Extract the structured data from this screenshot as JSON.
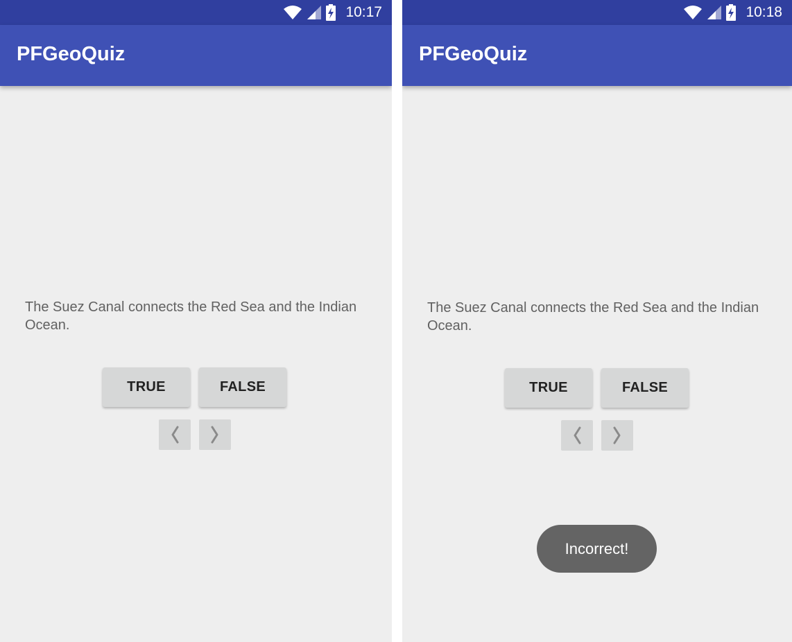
{
  "screens": [
    {
      "status_time": "10:17",
      "app_title": "PFGeoQuiz",
      "question_text": "The Suez Canal connects the Red Sea and the Indian Ocean.",
      "true_label": "TRUE",
      "false_label": "FALSE",
      "prev_icon": "chevron-left-icon",
      "next_icon": "chevron-right-icon"
    },
    {
      "status_time": "10:18",
      "app_title": "PFGeoQuiz",
      "question_text": "The Suez Canal connects the Red Sea and the Indian Ocean.",
      "true_label": "TRUE",
      "false_label": "FALSE",
      "prev_icon": "chevron-left-icon",
      "next_icon": "chevron-right-icon",
      "toast_text": "Incorrect!"
    }
  ],
  "colors": {
    "status_bar": "#303f9f",
    "app_bar": "#3f51b5",
    "background": "#eeeeee",
    "button": "#d6d7d7",
    "toast": "#646464"
  }
}
